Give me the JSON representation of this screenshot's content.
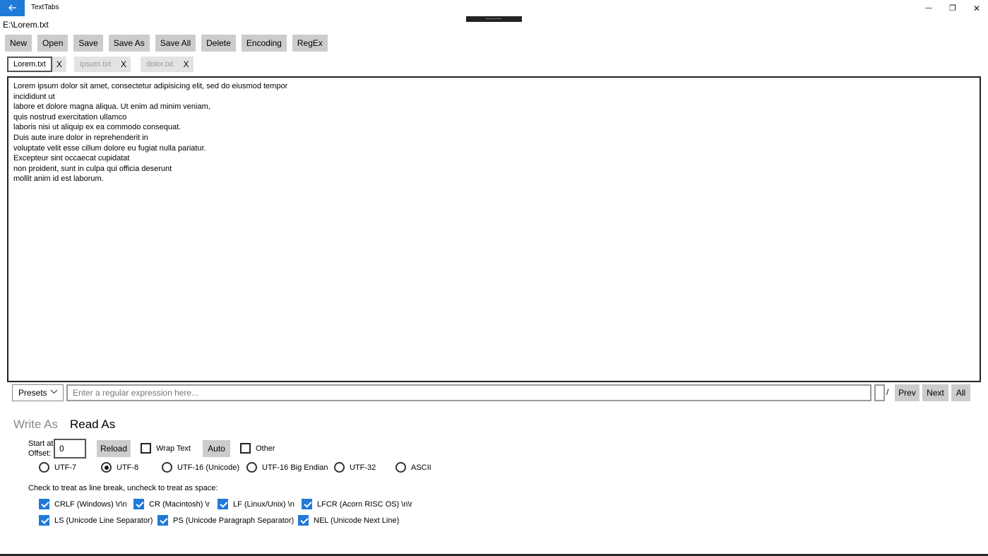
{
  "titlebar": {
    "app_title": "TextTabs",
    "back_icon": "arrow-left-icon",
    "min_glyph": "—",
    "max_glyph": "❐",
    "close_glyph": "✕"
  },
  "file_path": "E:\\Lorem.txt",
  "toolbar": {
    "new": "New",
    "open": "Open",
    "save": "Save",
    "save_as": "Save As",
    "save_all": "Save All",
    "delete": "Delete",
    "encoding": "Encoding",
    "regex": "RegEx"
  },
  "tabs": [
    {
      "label": "Lorem.txt",
      "close": "X",
      "active": true
    },
    {
      "label": "ipsum.txt",
      "close": "X",
      "active": false
    },
    {
      "label": "dolor.txt",
      "close": "X",
      "active": false
    }
  ],
  "editor": {
    "content": "Lorem ipsum dolor sit amet, consectetur adipisicing elit, sed do eiusmod tempor\nincididunt ut\nlabore et dolore magna aliqua. Ut enim ad minim veniam,\nquis nostrud exercitation ullamco\nlaboris nisi ut aliquip ex ea commodo consequat.\nDuis aute irure dolor in reprehenderit in\nvoluptate velit esse cillum dolore eu fugiat nulla pariatur.\nExcepteur sint occaecat cupidatat\nnon proident, sunt in culpa qui officia deserunt\nmollit anim id est laborum."
  },
  "search": {
    "presets_label": "Presets",
    "placeholder": "Enter a regular expression here...",
    "slash": "/",
    "prev": "Prev",
    "next": "Next",
    "all": "All"
  },
  "pivot": {
    "write_as": "Write As",
    "read_as": "Read As"
  },
  "read_as": {
    "start_at": "Start at",
    "offset": "Offset:",
    "offset_value": "0",
    "reload": "Reload",
    "wrap_text": "Wrap Text",
    "wrap_text_checked": false,
    "auto": "Auto",
    "other": "Other",
    "other_checked": false,
    "encodings": [
      {
        "label": "UTF-7",
        "selected": false
      },
      {
        "label": "UTF-8",
        "selected": true
      },
      {
        "label": "UTF-16 (Unicode)",
        "selected": false
      },
      {
        "label": "UTF-16 Big Endian",
        "selected": false
      },
      {
        "label": "UTF-32",
        "selected": false
      },
      {
        "label": "ASCII",
        "selected": false
      }
    ],
    "line_break_hint": "Check to treat as line break, uncheck to treat as space:",
    "line_breaks": [
      {
        "label": "CRLF (Windows) \\r\\n",
        "checked": true
      },
      {
        "label": "CR (Macintosh) \\r",
        "checked": true
      },
      {
        "label": "LF (Linux/Unix) \\n",
        "checked": true
      },
      {
        "label": "LFCR (Acorn RISC OS) \\n\\r",
        "checked": true
      },
      {
        "label": "LS (Unicode Line Separator)",
        "checked": true
      },
      {
        "label": "PS (Unicode Paragraph Separator)",
        "checked": true
      },
      {
        "label": "NEL (Unicode Next Line)",
        "checked": true
      }
    ]
  },
  "colors": {
    "accent": "#1f7ad8",
    "button_bg": "#cccccc"
  }
}
